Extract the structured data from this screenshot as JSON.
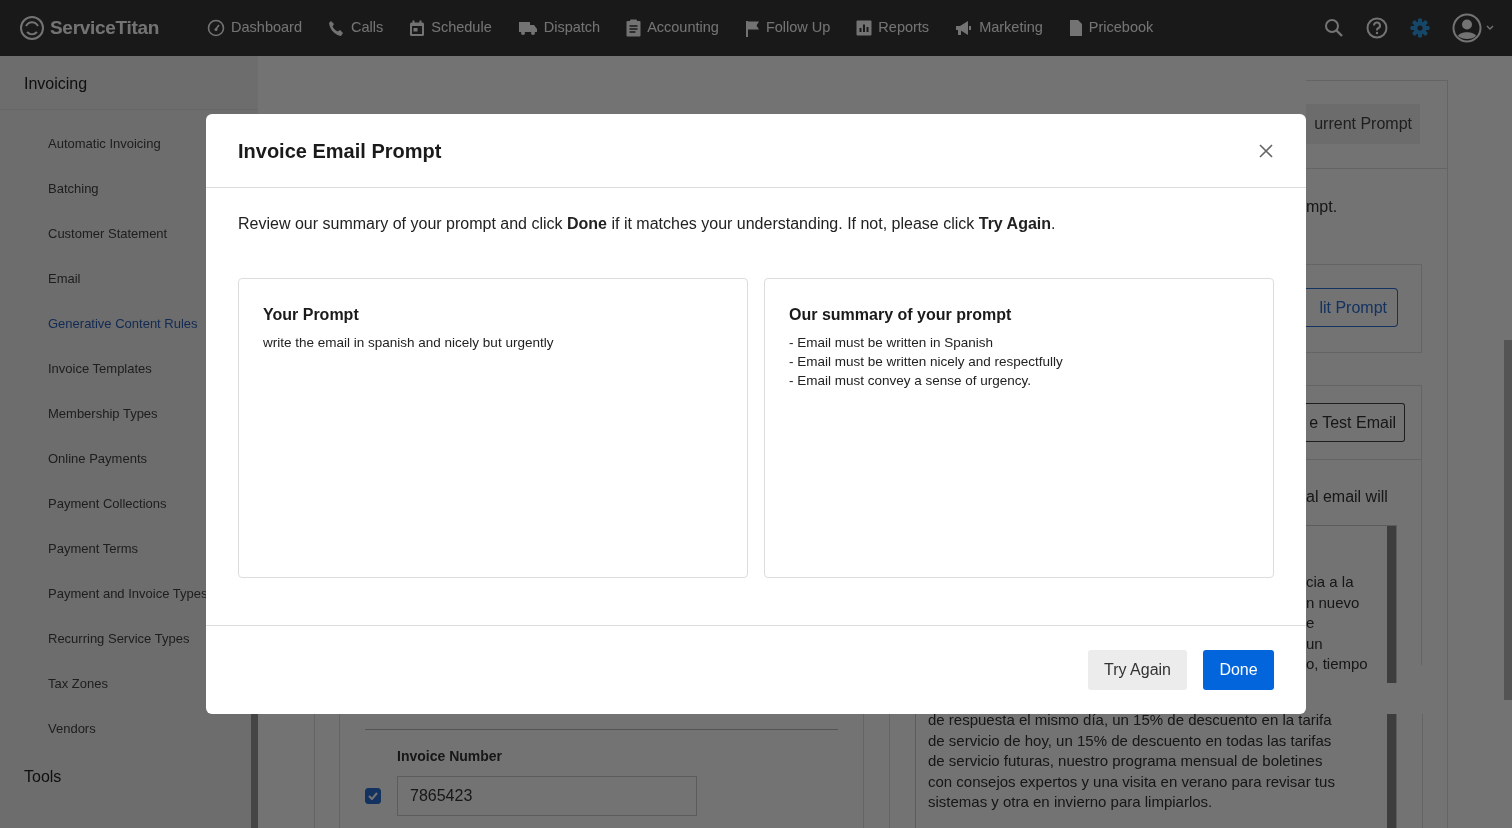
{
  "navbar": {
    "brand": "ServiceTitan",
    "items": [
      {
        "label": "Dashboard"
      },
      {
        "label": "Calls"
      },
      {
        "label": "Schedule"
      },
      {
        "label": "Dispatch"
      },
      {
        "label": "Accounting"
      },
      {
        "label": "Follow Up"
      },
      {
        "label": "Reports"
      },
      {
        "label": "Marketing"
      },
      {
        "label": "Pricebook"
      }
    ]
  },
  "sidebar": {
    "title": "Invoicing",
    "items": [
      {
        "label": "Automatic Invoicing",
        "selected": false
      },
      {
        "label": "Batching",
        "selected": false
      },
      {
        "label": "Customer Statement",
        "selected": false
      },
      {
        "label": "Email",
        "selected": false
      },
      {
        "label": "Generative Content Rules",
        "selected": true
      },
      {
        "label": "Invoice Templates",
        "selected": false
      },
      {
        "label": "Membership Types",
        "selected": false
      },
      {
        "label": "Online Payments",
        "selected": false
      },
      {
        "label": "Payment Collections",
        "selected": false
      },
      {
        "label": "Payment Terms",
        "selected": false
      },
      {
        "label": "Payment and Invoice Types",
        "selected": false
      },
      {
        "label": "Recurring Service Types",
        "selected": false
      },
      {
        "label": "Tax Zones",
        "selected": false
      },
      {
        "label": "Vendors",
        "selected": false
      }
    ],
    "next_section": "Tools"
  },
  "page": {
    "current_prompt_button": "urrent Prompt",
    "intro_text": "mpt.",
    "edit_prompt_button": "lit Prompt",
    "test_email_button": "e Test Email",
    "email_note": "al email will",
    "preview_lines_right": [
      "cia a la",
      "n nuevo",
      "e",
      "un",
      "o, tiempo"
    ],
    "preview_lines": [
      "de respuesta el mismo día, un 15% de descuento en la tarifa",
      "de servicio de hoy, un 15% de descuento en todas las tarifas",
      "de servicio futuras, nuestro programa mensual de boletines",
      "con consejos expertos y una visita en verano para revisar tus",
      "sistemas y otra en invierno para limpiarlos."
    ],
    "invoice_number": {
      "label": "Invoice Number",
      "checked": true,
      "value": "7865423"
    }
  },
  "modal": {
    "title": "Invoice Email Prompt",
    "message": "Review our summary of your prompt and click **Done** if it matches your understanding. If not, please click **Try Again**.",
    "your_prompt": {
      "title": "Your Prompt",
      "text": "write the email in spanish and nicely but urgently"
    },
    "summary": {
      "title": "Our summary of your prompt",
      "lines": [
        "- Email must be written in Spanish",
        "- Email must be written nicely and respectfully",
        "- Email must convey a sense of urgency."
      ]
    },
    "buttons": [
      {
        "label": "Try Again",
        "kind": "secondary"
      },
      {
        "label": "Done",
        "kind": "primary"
      }
    ]
  }
}
